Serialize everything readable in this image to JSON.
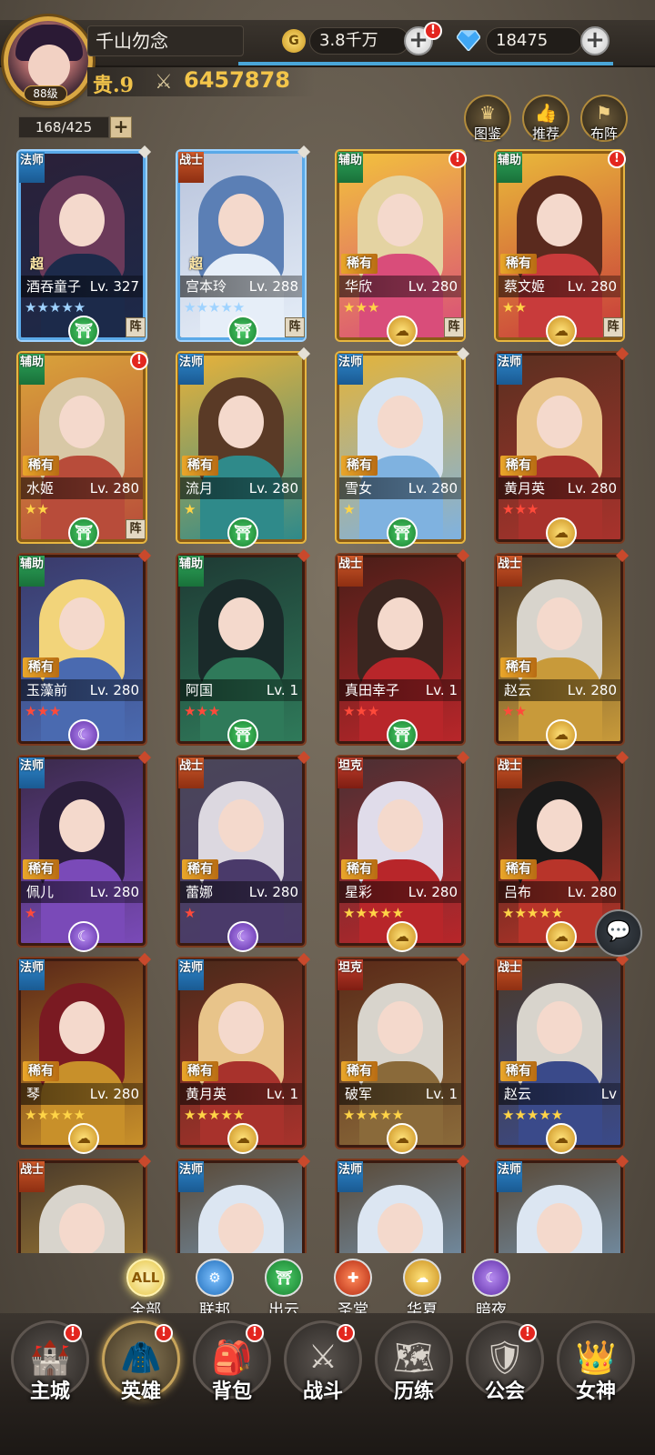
{
  "player": {
    "name": "千山勿念",
    "level_label": "88级",
    "rank_label": "贵.9",
    "power": "6457878"
  },
  "resources": {
    "gold": "3.8千万",
    "gold_icon": "G",
    "diamonds": "18475"
  },
  "roster": {
    "count": "168/425"
  },
  "side_buttons": [
    {
      "label": "图鉴",
      "icon": "crown-icon"
    },
    {
      "label": "推荐",
      "icon": "thumbs-up-icon"
    },
    {
      "label": "布阵",
      "icon": "formation-icon"
    }
  ],
  "marks": {
    "alert": "!",
    "formation": "阵",
    "all": "ALL"
  },
  "heroes": [
    {
      "name": "酒吞童子",
      "lv": "Lv. 327",
      "role": "法师",
      "rarity": "超",
      "stars": "★★★★★",
      "star_color": "blue",
      "faction": "出云",
      "frame": "super",
      "formation": true,
      "alert": false
    },
    {
      "name": "宫本玲",
      "lv": "Lv. 288",
      "role": "战士",
      "rarity": "超",
      "stars": "★★★★★",
      "star_color": "blue",
      "faction": "出云",
      "frame": "super",
      "formation": true,
      "alert": false
    },
    {
      "name": "华欣",
      "lv": "Lv. 280",
      "role": "辅助",
      "rarity": "稀有",
      "stars": "★★★",
      "star_color": "gold",
      "faction": "华夏",
      "frame": "gold",
      "formation": true,
      "alert": true
    },
    {
      "name": "蔡文姬",
      "lv": "Lv. 280",
      "role": "辅助",
      "rarity": "稀有",
      "stars": "★★",
      "star_color": "gold",
      "faction": "华夏",
      "frame": "gold",
      "formation": true,
      "alert": true
    },
    {
      "name": "水姬",
      "lv": "Lv. 280",
      "role": "辅助",
      "rarity": "稀有",
      "stars": "★★",
      "star_color": "gold",
      "faction": "出云",
      "frame": "gold",
      "formation": true,
      "alert": true
    },
    {
      "name": "流月",
      "lv": "Lv. 280",
      "role": "法师",
      "rarity": "稀有",
      "stars": "★",
      "star_color": "gold",
      "faction": "出云",
      "frame": "gold",
      "formation": false,
      "alert": false
    },
    {
      "name": "雪女",
      "lv": "Lv. 280",
      "role": "法师",
      "rarity": "稀有",
      "stars": "★",
      "star_color": "gold",
      "faction": "出云",
      "frame": "gold",
      "formation": false,
      "alert": false
    },
    {
      "name": "黄月英",
      "lv": "Lv. 280",
      "role": "法师",
      "rarity": "稀有",
      "stars": "★★★",
      "star_color": "red",
      "faction": "华夏",
      "frame": "red",
      "formation": false,
      "alert": false
    },
    {
      "name": "玉藻前",
      "lv": "Lv. 280",
      "role": "辅助",
      "rarity": "稀有",
      "stars": "★★★",
      "star_color": "red",
      "faction": "暗夜",
      "frame": "red",
      "formation": false,
      "alert": false
    },
    {
      "name": "阿国",
      "lv": "Lv. 1",
      "role": "辅助",
      "rarity": "",
      "stars": "★★★",
      "star_color": "red",
      "faction": "出云",
      "frame": "red",
      "formation": false,
      "alert": false
    },
    {
      "name": "真田幸子",
      "lv": "Lv. 1",
      "role": "战士",
      "rarity": "",
      "stars": "★★★",
      "star_color": "red",
      "faction": "出云",
      "frame": "red",
      "formation": false,
      "alert": false
    },
    {
      "name": "赵云",
      "lv": "Lv. 280",
      "role": "战士",
      "rarity": "稀有",
      "stars": "★★",
      "star_color": "red",
      "faction": "华夏",
      "frame": "red",
      "formation": false,
      "alert": false
    },
    {
      "name": "佩儿",
      "lv": "Lv. 280",
      "role": "法师",
      "rarity": "稀有",
      "stars": "★",
      "star_color": "red",
      "faction": "暗夜",
      "frame": "red",
      "formation": false,
      "alert": false
    },
    {
      "name": "蕾娜",
      "lv": "Lv. 280",
      "role": "战士",
      "rarity": "稀有",
      "stars": "★",
      "star_color": "red",
      "faction": "暗夜",
      "frame": "red",
      "formation": false,
      "alert": false
    },
    {
      "name": "星彩",
      "lv": "Lv. 280",
      "role": "坦克",
      "rarity": "稀有",
      "stars": "★★★★★",
      "star_color": "gold",
      "faction": "华夏",
      "frame": "red",
      "formation": false,
      "alert": false
    },
    {
      "name": "吕布",
      "lv": "Lv. 280",
      "role": "战士",
      "rarity": "稀有",
      "stars": "★★★★★",
      "star_color": "gold",
      "faction": "华夏",
      "frame": "red",
      "formation": false,
      "alert": false
    },
    {
      "name": "琴",
      "lv": "Lv. 280",
      "role": "法师",
      "rarity": "稀有",
      "stars": "★★★★★",
      "star_color": "gold",
      "faction": "华夏",
      "frame": "red",
      "formation": false,
      "alert": false
    },
    {
      "name": "黄月英",
      "lv": "Lv. 1",
      "role": "法师",
      "rarity": "稀有",
      "stars": "★★★★★",
      "star_color": "gold",
      "faction": "华夏",
      "frame": "red",
      "formation": false,
      "alert": false
    },
    {
      "name": "破军",
      "lv": "Lv. 1",
      "role": "坦克",
      "rarity": "稀有",
      "stars": "★★★★★",
      "star_color": "gold",
      "faction": "华夏",
      "frame": "red",
      "formation": false,
      "alert": false
    },
    {
      "name": "赵云",
      "lv": "Lv",
      "role": "战士",
      "rarity": "稀有",
      "stars": "★★★★★",
      "star_color": "gold",
      "faction": "华夏",
      "frame": "red",
      "formation": false,
      "alert": false
    },
    {
      "name": "",
      "lv": "",
      "role": "战士",
      "rarity": "",
      "stars": "",
      "star_color": "gold",
      "faction": "",
      "frame": "red",
      "formation": false,
      "alert": false
    },
    {
      "name": "",
      "lv": "",
      "role": "法师",
      "rarity": "",
      "stars": "",
      "star_color": "gold",
      "faction": "",
      "frame": "red",
      "formation": false,
      "alert": false
    },
    {
      "name": "",
      "lv": "",
      "role": "法师",
      "rarity": "",
      "stars": "",
      "star_color": "gold",
      "faction": "",
      "frame": "red",
      "formation": false,
      "alert": false
    },
    {
      "name": "",
      "lv": "",
      "role": "法师",
      "rarity": "",
      "stars": "",
      "star_color": "gold",
      "faction": "",
      "frame": "red",
      "formation": false,
      "alert": false
    }
  ],
  "filters": [
    {
      "label": "全部",
      "key": "all",
      "icon": "all-icon"
    },
    {
      "label": "联邦",
      "key": "lianbang",
      "icon": "gear-icon"
    },
    {
      "label": "出云",
      "key": "chuyun",
      "icon": "torii-icon"
    },
    {
      "label": "圣堂",
      "key": "shengtang",
      "icon": "sword-icon"
    },
    {
      "label": "华夏",
      "key": "huaxia",
      "icon": "cloud-icon"
    },
    {
      "label": "暗夜",
      "key": "anye",
      "icon": "moon-icon"
    }
  ],
  "nav": [
    {
      "label": "主城",
      "icon": "castle-icon",
      "alert": true
    },
    {
      "label": "英雄",
      "icon": "hood-icon",
      "alert": true,
      "active": true
    },
    {
      "label": "背包",
      "icon": "backpack-icon",
      "alert": true
    },
    {
      "label": "战斗",
      "icon": "crossed-swords-icon",
      "alert": true
    },
    {
      "label": "历练",
      "icon": "map-icon",
      "alert": false
    },
    {
      "label": "公会",
      "icon": "guild-shield-icon",
      "alert": true
    },
    {
      "label": "女神",
      "icon": "goddess-icon",
      "alert": false
    }
  ]
}
